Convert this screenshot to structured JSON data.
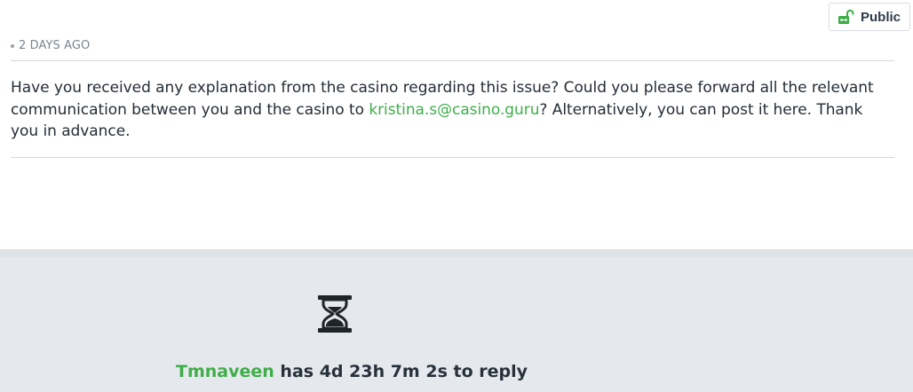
{
  "badge": {
    "label": "Public",
    "icon": "unlocked-lock-icon",
    "icon_color": "#3fae49"
  },
  "post": {
    "meta": "2 DAYS AGO",
    "text_before": "Have you received any explanation from the casino regarding this issue? Could you please forward all the relevant communication between you and the casino to ",
    "email": "kristina.s@casino.guru",
    "text_after": "? Alternatively, you can post it here. Thank you in advance."
  },
  "reply_status": {
    "icon": "hourglass-icon",
    "username": "Tmnaveen",
    "message": "has 4d 23h 7m 2s to reply"
  },
  "colors": {
    "accent": "#3fae49",
    "panel_bg": "#e5e8ed",
    "text": "#252d35",
    "muted": "#7b858f"
  }
}
